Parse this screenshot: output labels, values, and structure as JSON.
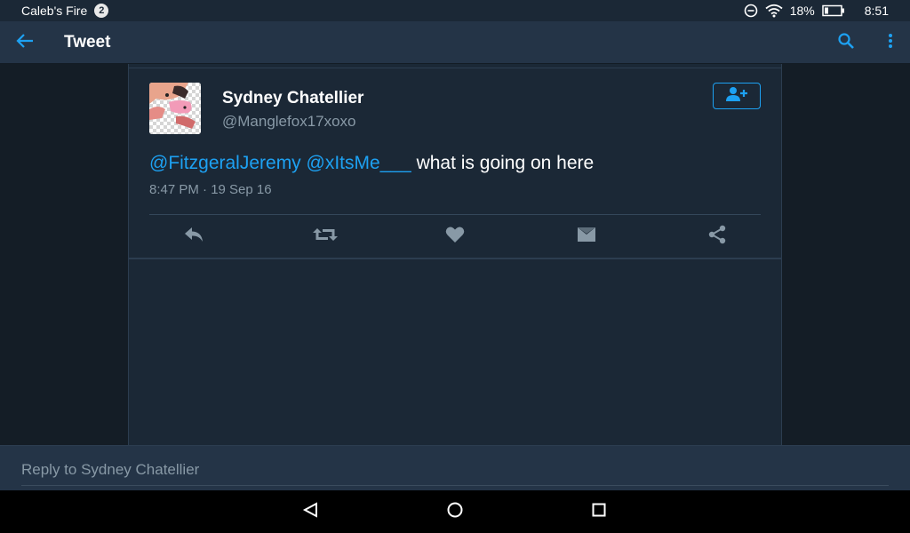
{
  "status_bar": {
    "device_name": "Caleb's Fire",
    "notification_count": "2",
    "battery_percent": "18%",
    "time": "8:51",
    "icons": [
      "do-not-disturb-icon",
      "wifi-icon",
      "battery-icon"
    ]
  },
  "app_bar": {
    "title": "Tweet",
    "icons": [
      "back-arrow-icon",
      "search-icon",
      "more-vert-icon"
    ]
  },
  "tweet": {
    "display_name": "Sydney Chatellier",
    "handle": "@Manglefox17xoxo",
    "mention_1": "@FitzgeralJeremy",
    "mention_2": "@xItsMe___",
    "text": "what is going on here",
    "timestamp": "8:47 PM · 19 Sep 16",
    "actions": [
      "reply-icon",
      "retweet-icon",
      "like-icon",
      "direct-message-icon",
      "share-icon"
    ],
    "follow_icon": "add-user-icon"
  },
  "reply": {
    "placeholder": "Reply to Sydney Chatellier"
  },
  "nav_bar": {
    "icons": [
      "nav-back-icon",
      "nav-home-icon",
      "nav-recents-icon"
    ]
  },
  "colors": {
    "accent": "#1da1f2",
    "background": "#141d26",
    "card": "#1b2836",
    "app_bar": "#243447",
    "secondary_text": "#8899a6"
  }
}
